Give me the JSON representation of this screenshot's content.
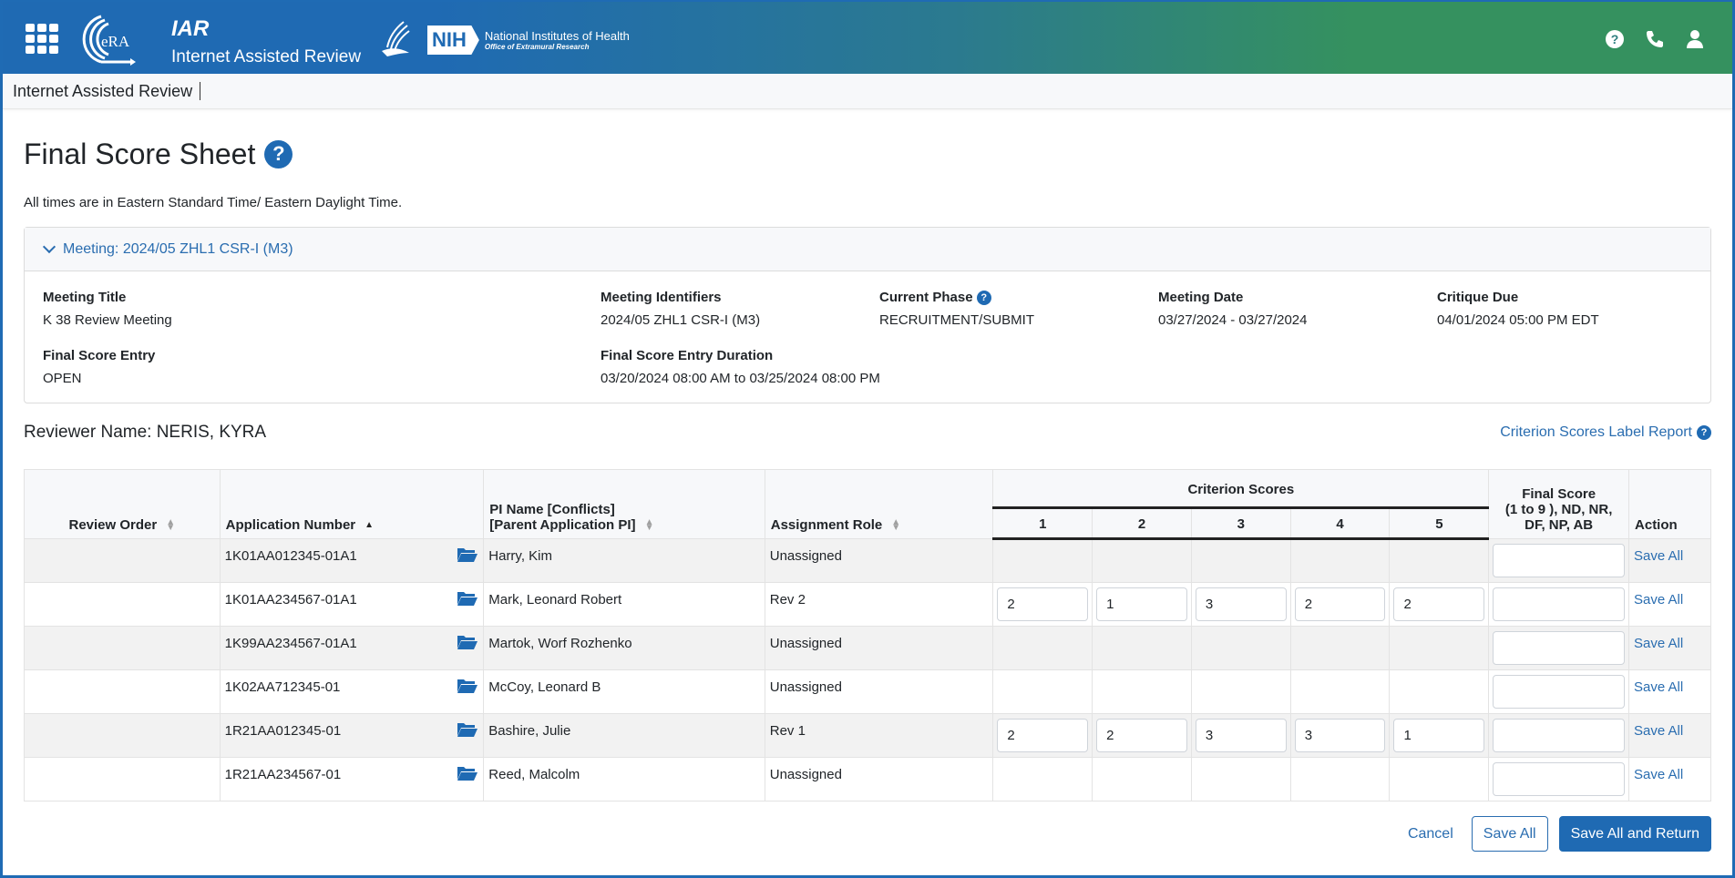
{
  "header": {
    "app_abbr": "IAR",
    "app_full": "Internet Assisted Review",
    "era_logo_text": "eRA",
    "nih_box": "NIH",
    "nih_name": "National Institutes of Health",
    "nih_office": "Office of Extramural Research",
    "icons": [
      "apps-grid-icon",
      "help-icon",
      "phone-icon",
      "user-icon"
    ]
  },
  "subnav": {
    "breadcrumb": "Internet Assisted Review"
  },
  "page": {
    "title": "Final Score Sheet",
    "help_glyph": "?",
    "timezone_note": "All times are in Eastern Standard Time/ Eastern Daylight Time."
  },
  "meeting": {
    "header_label": "Meeting:  2024/05 ZHL1 CSR-I (M3)",
    "fields": {
      "title_label": "Meeting Title",
      "title_value": "K 38 Review Meeting",
      "identifiers_label": "Meeting Identifiers",
      "identifiers_value": "2024/05 ZHL1 CSR-I (M3)",
      "phase_label": "Current Phase",
      "phase_value": "RECRUITMENT/SUBMIT",
      "date_label": "Meeting Date",
      "date_value": "03/27/2024 - 03/27/2024",
      "critique_label": "Critique Due",
      "critique_value": "04/01/2024 05:00 PM EDT",
      "entry_label": "Final Score Entry",
      "entry_value": "OPEN",
      "duration_label": "Final Score Entry Duration",
      "duration_value": "03/20/2024 08:00 AM  to  03/25/2024 08:00 PM"
    }
  },
  "reviewer": {
    "label": "Reviewer Name: NERIS, KYRA",
    "report_link": "Criterion Scores Label Report"
  },
  "table": {
    "headers": {
      "review_order": "Review Order",
      "application_number": "Application Number",
      "pi_name_line1": "PI Name [Conflicts]",
      "pi_name_line2": "[Parent Application PI]",
      "assignment_role": "Assignment Role",
      "criterion_scores": "Criterion Scores",
      "criteria": [
        "1",
        "2",
        "3",
        "4",
        "5"
      ],
      "final_score_line1": "Final Score",
      "final_score_line2": "(1 to 9 ), ND, NR,",
      "final_score_line3": "DF, NP, AB",
      "action": "Action"
    },
    "sort": {
      "active_column": "application_number",
      "direction": "ascending"
    },
    "rows": [
      {
        "review_order": "",
        "application_number": "1K01AA012345-01A1",
        "pi_name": "Harry, Kim",
        "assignment_role": "Unassigned",
        "criterion_scores": null,
        "final_score": "",
        "action": "Save All"
      },
      {
        "review_order": "",
        "application_number": "1K01AA234567-01A1",
        "pi_name": "Mark, Leonard Robert",
        "assignment_role": "Rev 2",
        "criterion_scores": [
          "2",
          "1",
          "3",
          "2",
          "2"
        ],
        "final_score": "",
        "action": "Save All"
      },
      {
        "review_order": "",
        "application_number": "1K99AA234567-01A1",
        "pi_name": "Martok, Worf Rozhenko",
        "assignment_role": "Unassigned",
        "criterion_scores": null,
        "final_score": "",
        "action": "Save All"
      },
      {
        "review_order": "",
        "application_number": "1K02AA712345-01",
        "pi_name": "McCoy, Leonard B",
        "assignment_role": "Unassigned",
        "criterion_scores": null,
        "final_score": "",
        "action": "Save All"
      },
      {
        "review_order": "",
        "application_number": "1R21AA012345-01",
        "pi_name": "Bashire, Julie",
        "assignment_role": "Rev 1",
        "criterion_scores": [
          "2",
          "2",
          "3",
          "3",
          "1"
        ],
        "final_score": "",
        "action": "Save All"
      },
      {
        "review_order": "",
        "application_number": "1R21AA234567-01",
        "pi_name": "Reed, Malcolm",
        "assignment_role": "Unassigned",
        "criterion_scores": null,
        "final_score": "",
        "action": "Save All"
      }
    ]
  },
  "footer": {
    "cancel": "Cancel",
    "save_all": "Save All",
    "save_all_return": "Save All and Return"
  },
  "colors": {
    "brand_blue": "#1f6ab3",
    "brand_green": "#35915f",
    "link": "#2a6db0"
  }
}
